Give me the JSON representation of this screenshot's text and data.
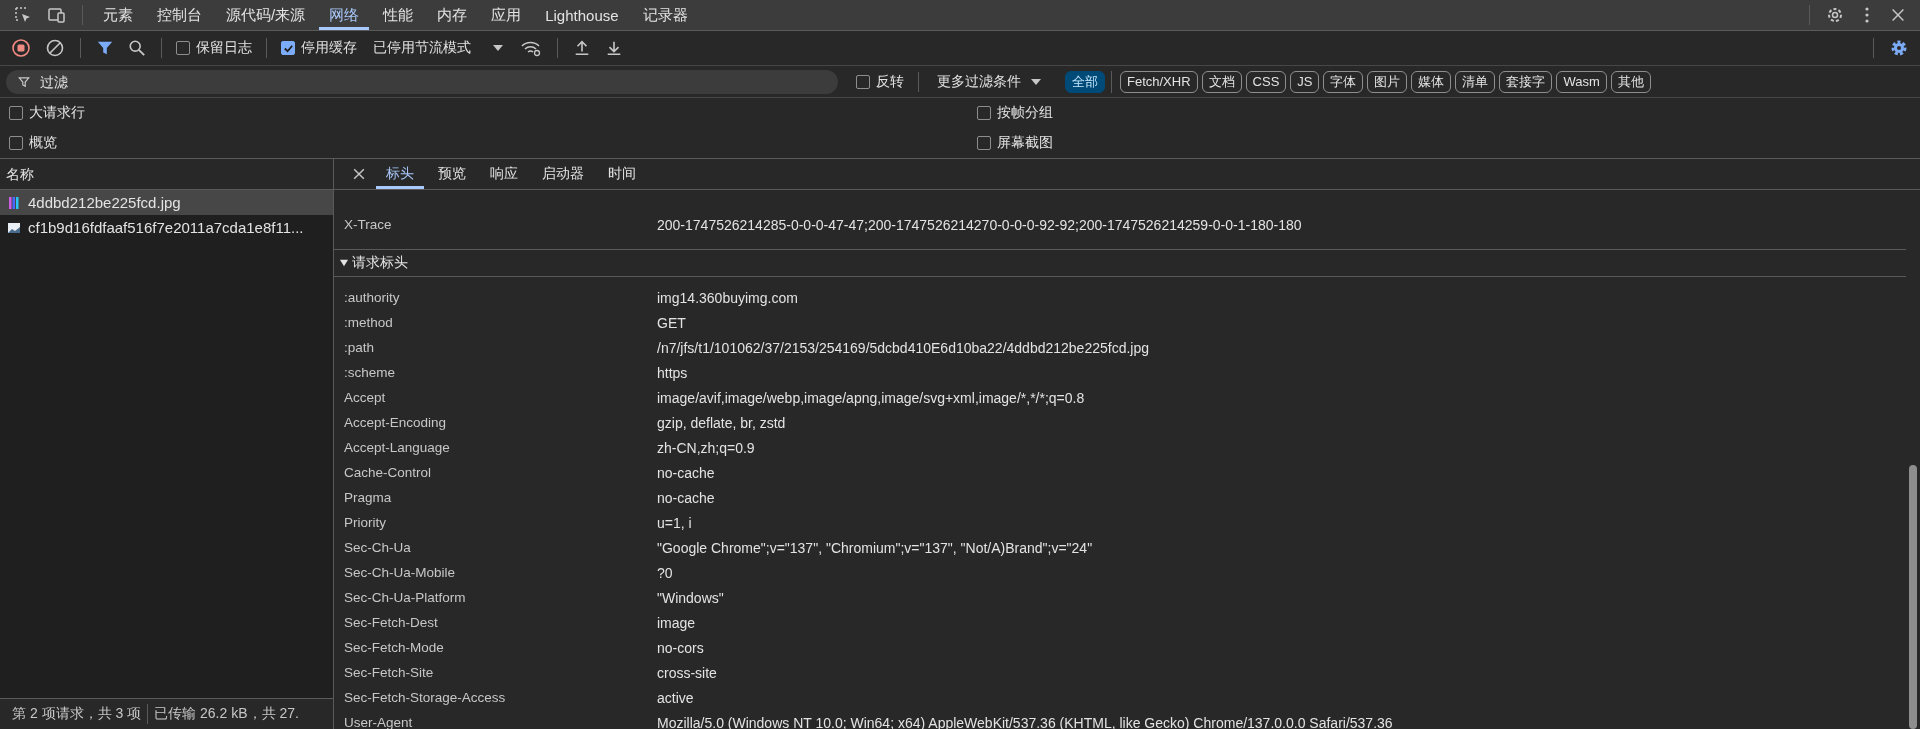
{
  "main_tabs": [
    {
      "label": "元素",
      "selected": false
    },
    {
      "label": "控制台",
      "selected": false
    },
    {
      "label": "源代码/来源",
      "selected": false
    },
    {
      "label": "网络",
      "selected": true
    },
    {
      "label": "性能",
      "selected": false
    },
    {
      "label": "内存",
      "selected": false
    },
    {
      "label": "应用",
      "selected": false
    },
    {
      "label": "Lighthouse",
      "selected": false
    },
    {
      "label": "记录器",
      "selected": false
    }
  ],
  "toolbar": {
    "recording": true,
    "preserve_log": {
      "label": "保留日志",
      "checked": false
    },
    "disable_cache": {
      "label": "停用缓存",
      "checked": true
    },
    "throttling": "已停用节流模式"
  },
  "filter": {
    "placeholder": "过滤",
    "invert": {
      "label": "反转",
      "checked": false
    },
    "more_filters": "更多过滤条件",
    "types": [
      {
        "label": "全部",
        "selected": true
      },
      {
        "label": "Fetch/XHR",
        "selected": false
      },
      {
        "label": "文档",
        "selected": false
      },
      {
        "label": "CSS",
        "selected": false
      },
      {
        "label": "JS",
        "selected": false
      },
      {
        "label": "字体",
        "selected": false
      },
      {
        "label": "图片",
        "selected": false
      },
      {
        "label": "媒体",
        "selected": false
      },
      {
        "label": "清单",
        "selected": false
      },
      {
        "label": "套接字",
        "selected": false
      },
      {
        "label": "Wasm",
        "selected": false
      },
      {
        "label": "其他",
        "selected": false
      }
    ]
  },
  "options": [
    {
      "label": "大请求行",
      "checked": false
    },
    {
      "label": "按帧分组",
      "checked": false
    },
    {
      "label": "概览",
      "checked": false
    },
    {
      "label": "屏幕截图",
      "checked": false
    }
  ],
  "requests": {
    "column": "名称",
    "rows": [
      {
        "name": "4ddbd212be225fcd.jpg",
        "selected": true,
        "kind": "bars"
      },
      {
        "name": "cf1b9d16fdfaaf516f7e2011a7cda1e8f11...",
        "selected": false,
        "kind": "thumbnail"
      }
    ]
  },
  "detail_tabs": [
    {
      "label": "标头",
      "selected": true
    },
    {
      "label": "预览",
      "selected": false
    },
    {
      "label": "响应",
      "selected": false
    },
    {
      "label": "启动器",
      "selected": false
    },
    {
      "label": "时间",
      "selected": false
    }
  ],
  "response_headers": [
    {
      "name": "X-Trace",
      "value": "200-1747526214285-0-0-0-47-47;200-1747526214270-0-0-0-92-92;200-1747526214259-0-0-1-180-180"
    }
  ],
  "request_headers": {
    "title": "请求标头",
    "expanded": true,
    "rows": [
      {
        "name": ":authority",
        "value": "img14.360buyimg.com"
      },
      {
        "name": ":method",
        "value": "GET"
      },
      {
        "name": ":path",
        "value": "/n7/jfs/t1/101062/37/2153/254169/5dcbd410E6d10ba22/4ddbd212be225fcd.jpg"
      },
      {
        "name": ":scheme",
        "value": "https"
      },
      {
        "name": "Accept",
        "value": "image/avif,image/webp,image/apng,image/svg+xml,image/*,*/*;q=0.8"
      },
      {
        "name": "Accept-Encoding",
        "value": "gzip, deflate, br, zstd"
      },
      {
        "name": "Accept-Language",
        "value": "zh-CN,zh;q=0.9"
      },
      {
        "name": "Cache-Control",
        "value": "no-cache"
      },
      {
        "name": "Pragma",
        "value": "no-cache"
      },
      {
        "name": "Priority",
        "value": "u=1, i"
      },
      {
        "name": "Sec-Ch-Ua",
        "value": "\"Google Chrome\";v=\"137\", \"Chromium\";v=\"137\", \"Not/A)Brand\";v=\"24\""
      },
      {
        "name": "Sec-Ch-Ua-Mobile",
        "value": "?0"
      },
      {
        "name": "Sec-Ch-Ua-Platform",
        "value": "\"Windows\""
      },
      {
        "name": "Sec-Fetch-Dest",
        "value": "image"
      },
      {
        "name": "Sec-Fetch-Mode",
        "value": "no-cors"
      },
      {
        "name": "Sec-Fetch-Site",
        "value": "cross-site"
      },
      {
        "name": "Sec-Fetch-Storage-Access",
        "value": "active"
      },
      {
        "name": "User-Agent",
        "value": "Mozilla/5.0 (Windows NT 10.0; Win64; x64) AppleWebKit/537.36 (KHTML, like Gecko) Chrome/137.0.0.0 Safari/537.36"
      }
    ]
  },
  "status_bar": [
    "第 2 项请求，共 3 项",
    "已传输 26.2 kB，共 27."
  ]
}
